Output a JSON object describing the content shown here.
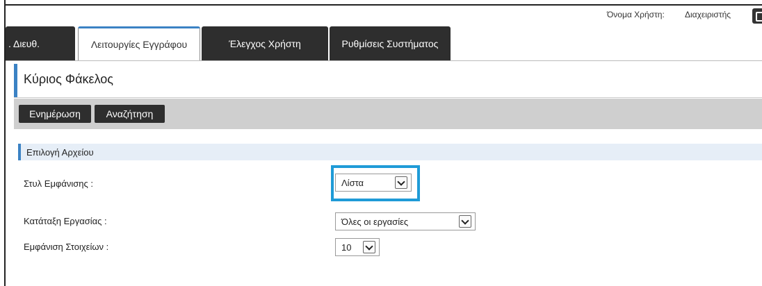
{
  "header": {
    "user_label": "Όνομα Χρήστη:",
    "user_value": "Διαχειριστής"
  },
  "tabs": [
    {
      "label": ". Διευθ."
    },
    {
      "label": "Λειτουργίες Εγγράφου"
    },
    {
      "label": "Έλεγχος Χρήστη"
    },
    {
      "label": "Ρυθμίσεις Συστήματος"
    }
  ],
  "page": {
    "title": "Κύριος Φάκελος"
  },
  "toolbar": {
    "update_label": "Ενημέρωση",
    "search_label": "Αναζήτηση"
  },
  "section": {
    "title": "Επιλογή Αρχείου"
  },
  "fields": {
    "display_style": {
      "label": "Στυλ Εμφάνισης :",
      "value": "Λίστα"
    },
    "job_sort": {
      "label": "Κατάταξη Εργασίας :",
      "value": "Όλες οι εργασίες"
    },
    "item_count": {
      "label": "Εμφάνιση Στοιχείων :",
      "value": "10"
    }
  },
  "colors": {
    "accent": "#3b82c4",
    "highlight": "#1f9bd7",
    "dark_button": "#2e2e2e"
  }
}
